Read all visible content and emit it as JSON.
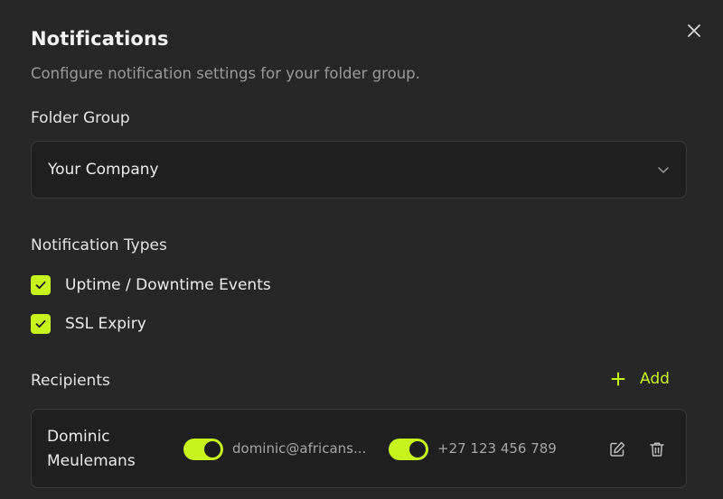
{
  "modal": {
    "title": "Notifications",
    "subtitle": "Configure notification settings for your folder group."
  },
  "folder_group": {
    "label": "Folder Group",
    "selected": "Your Company"
  },
  "notification_types": {
    "label": "Notification Types",
    "items": [
      {
        "label": "Uptime / Downtime Events",
        "checked": true
      },
      {
        "label": "SSL Expiry",
        "checked": true
      }
    ]
  },
  "recipients": {
    "label": "Recipients",
    "add_label": "Add",
    "items": [
      {
        "name": "Dominic Meulemans",
        "email": "dominic@africans...",
        "email_enabled": true,
        "phone": "+27 123 456 789",
        "phone_enabled": true
      }
    ]
  },
  "colors": {
    "accent": "#c6f41c",
    "background": "#262626",
    "surface": "#1f1f1f"
  },
  "icons": [
    "close-icon",
    "chevron-down-icon",
    "check-icon",
    "plus-icon",
    "edit-icon",
    "trash-icon"
  ]
}
